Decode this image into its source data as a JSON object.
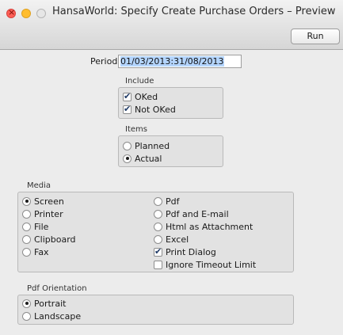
{
  "window": {
    "title": "HansaWorld: Specify Create Purchase Orders – Preview"
  },
  "toolbar": {
    "run_label": "Run"
  },
  "period": {
    "label": "Period",
    "value": "01/03/2013:31/08/2013"
  },
  "include": {
    "title": "Include",
    "options": [
      {
        "label": "OKed",
        "checked": true
      },
      {
        "label": "Not OKed",
        "checked": true
      }
    ]
  },
  "items": {
    "title": "Items",
    "options": [
      {
        "label": "Planned",
        "selected": false
      },
      {
        "label": "Actual",
        "selected": true
      }
    ]
  },
  "media": {
    "title": "Media",
    "left": [
      {
        "label": "Screen",
        "selected": true
      },
      {
        "label": "Printer",
        "selected": false
      },
      {
        "label": "File",
        "selected": false
      },
      {
        "label": "Clipboard",
        "selected": false
      },
      {
        "label": "Fax",
        "selected": false
      }
    ],
    "right": [
      {
        "label": "Pdf",
        "selected": false
      },
      {
        "label": "Pdf and E-mail",
        "selected": false
      },
      {
        "label": "Html as Attachment",
        "selected": false
      },
      {
        "label": "Excel",
        "selected": false
      }
    ],
    "checks": [
      {
        "label": "Print Dialog",
        "checked": true
      },
      {
        "label": "Ignore Timeout Limit",
        "checked": false
      }
    ]
  },
  "pdf_orientation": {
    "title": "Pdf Orientation",
    "options": [
      {
        "label": "Portrait",
        "selected": true
      },
      {
        "label": "Landscape",
        "selected": false
      }
    ]
  }
}
